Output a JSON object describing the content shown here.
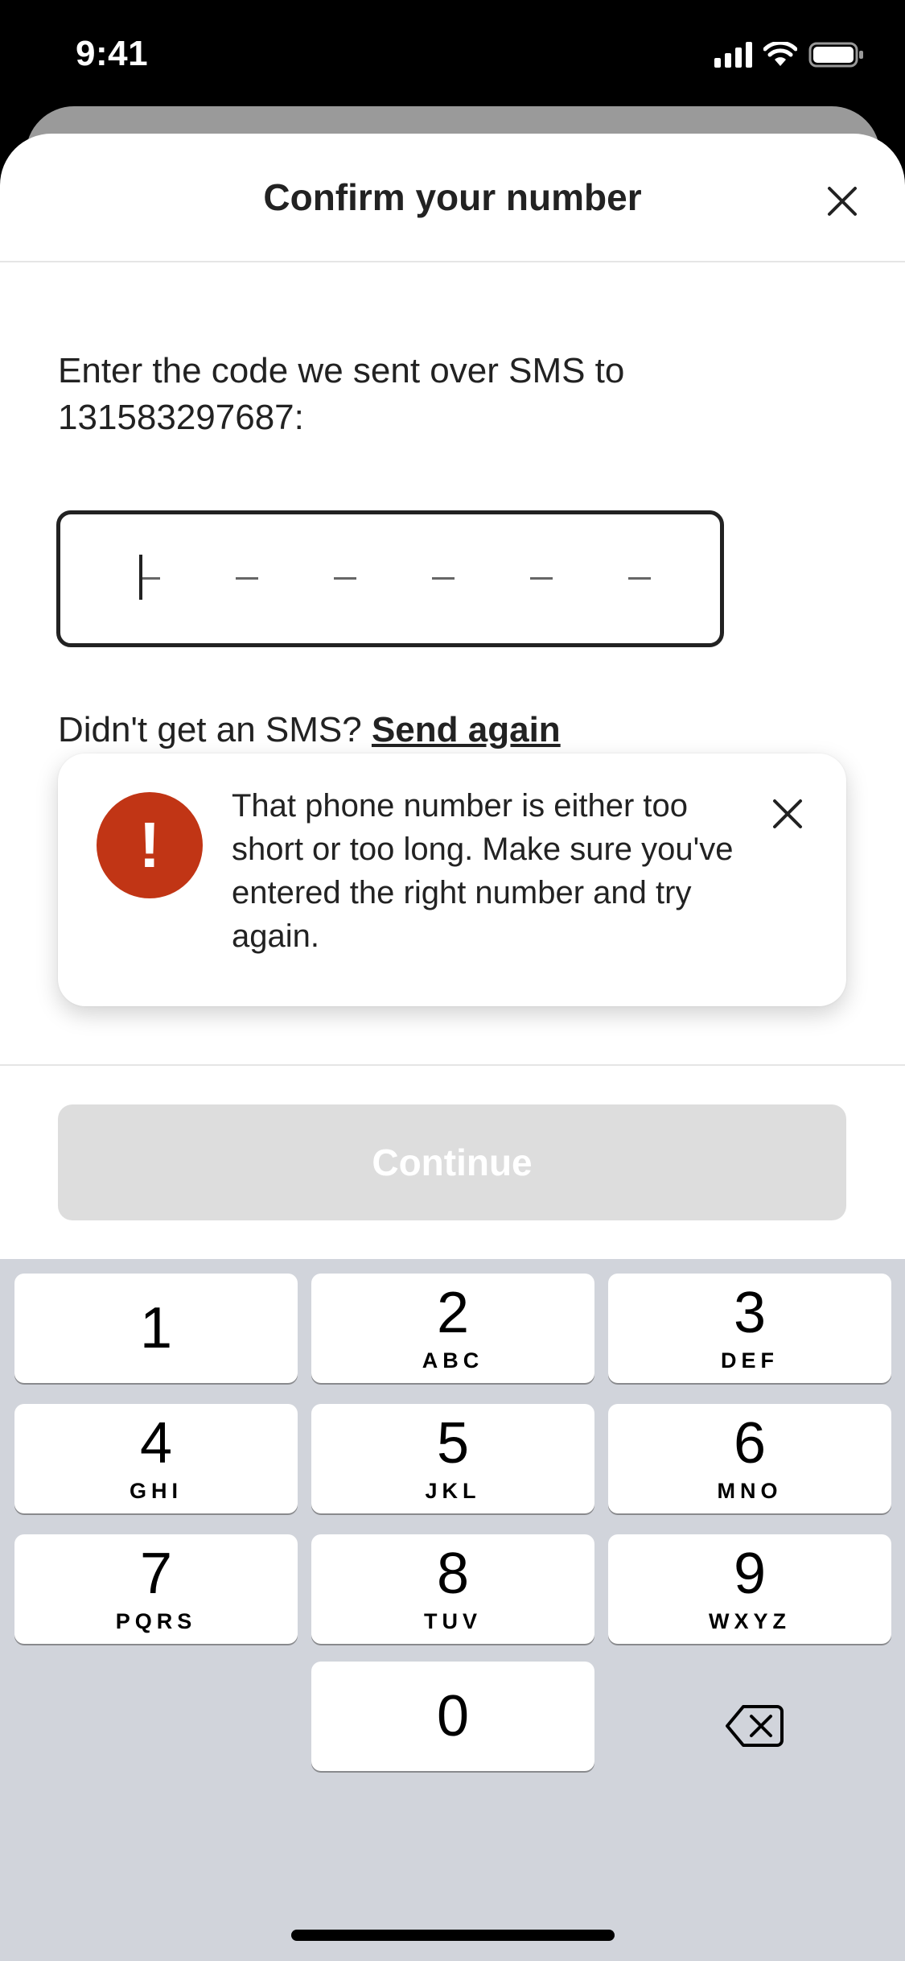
{
  "status_bar": {
    "time": "9:41"
  },
  "header": {
    "title": "Confirm your number",
    "close_icon": "close-icon"
  },
  "instructions": {
    "line1": "Enter the code we sent over SMS to",
    "line2": "131583297687:"
  },
  "code_input": {
    "value": "",
    "slots": 6
  },
  "resend": {
    "prompt": "Didn't get an SMS?",
    "link": "Send again"
  },
  "error_toast": {
    "icon": "exclamation-icon",
    "icon_glyph": "!",
    "message": "That phone number is either too short or too long. Make sure you've entered the right number and try again.",
    "color": "#C13515"
  },
  "continue_button": {
    "label": "Continue",
    "disabled": true
  },
  "keypad": {
    "keys": [
      {
        "num": "1",
        "letters": ""
      },
      {
        "num": "2",
        "letters": "ABC"
      },
      {
        "num": "3",
        "letters": "DEF"
      },
      {
        "num": "4",
        "letters": "GHI"
      },
      {
        "num": "5",
        "letters": "JKL"
      },
      {
        "num": "6",
        "letters": "MNO"
      },
      {
        "num": "7",
        "letters": "PQRS"
      },
      {
        "num": "8",
        "letters": "TUV"
      },
      {
        "num": "9",
        "letters": "WXYZ"
      },
      {
        "num": "0",
        "letters": ""
      }
    ],
    "delete_icon": "backspace-icon"
  }
}
